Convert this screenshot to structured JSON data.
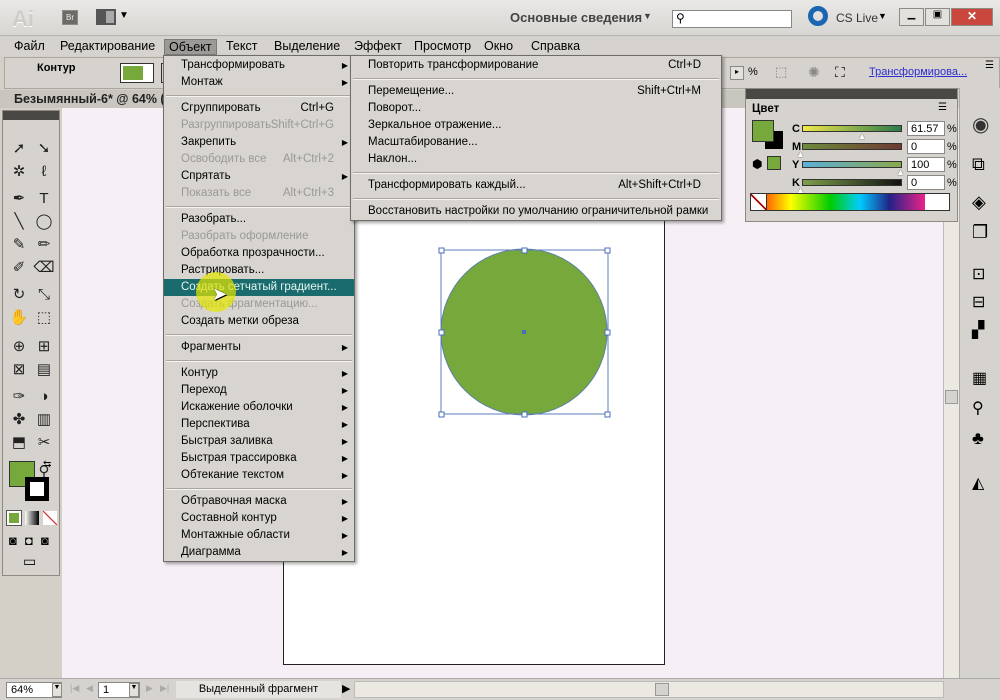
{
  "titlebar": {
    "app_logo": "Ai",
    "bridge": "Br",
    "workspace": "Основные сведения",
    "search_placeholder": "",
    "cs_live": "CS Live"
  },
  "menubar": [
    "Файл",
    "Редактирование",
    "Объект",
    "Текст",
    "Выделение",
    "Эффект",
    "Просмотр",
    "Окно",
    "Справка"
  ],
  "menubar_active": "Объект",
  "control": {
    "label": "Контур",
    "fill_color": "#76a83c",
    "percent": "%",
    "transform_link": "Трансформирова..."
  },
  "document": {
    "tab": "Безымянный-6* @ 64% ("
  },
  "object_menu": [
    {
      "label": "Трансформировать",
      "submenu": true
    },
    {
      "label": "Монтаж",
      "submenu": true
    },
    {
      "sep": true
    },
    {
      "label": "Сгруппировать",
      "shortcut": "Ctrl+G"
    },
    {
      "label": "Разгруппировать",
      "shortcut": "Shift+Ctrl+G",
      "disabled": true
    },
    {
      "label": "Закрепить",
      "submenu": true
    },
    {
      "label": "Освободить все",
      "shortcut": "Alt+Ctrl+2",
      "disabled": true
    },
    {
      "label": "Спрятать",
      "submenu": true
    },
    {
      "label": "Показать все",
      "shortcut": "Alt+Ctrl+3",
      "disabled": true
    },
    {
      "sep": true
    },
    {
      "label": "Разобрать..."
    },
    {
      "label": "Разобрать оформление",
      "disabled": true
    },
    {
      "label": "Обработка прозрачности..."
    },
    {
      "label": "Растрировать..."
    },
    {
      "label": "Создать сетчатый градиент...",
      "highlighted": true
    },
    {
      "label": "Создать фрагментацию...",
      "disabled": true
    },
    {
      "label": "Создать метки обреза"
    },
    {
      "sep": true
    },
    {
      "label": "Фрагменты",
      "submenu": true
    },
    {
      "sep": true
    },
    {
      "label": "Контур",
      "submenu": true
    },
    {
      "label": "Переход",
      "submenu": true
    },
    {
      "label": "Искажение оболочки",
      "submenu": true
    },
    {
      "label": "Перспектива",
      "submenu": true
    },
    {
      "label": "Быстрая заливка",
      "submenu": true
    },
    {
      "label": "Быстрая трассировка",
      "submenu": true
    },
    {
      "label": "Обтекание текстом",
      "submenu": true
    },
    {
      "sep": true
    },
    {
      "label": "Обтравочная маска",
      "submenu": true
    },
    {
      "label": "Составной контур",
      "submenu": true
    },
    {
      "label": "Монтажные области",
      "submenu": true
    },
    {
      "label": "Диаграмма",
      "submenu": true
    }
  ],
  "transform_submenu": [
    {
      "label": "Повторить трансформирование",
      "shortcut": "Ctrl+D"
    },
    {
      "sep": true
    },
    {
      "label": "Перемещение...",
      "shortcut": "Shift+Ctrl+M"
    },
    {
      "label": "Поворот..."
    },
    {
      "label": "Зеркальное отражение..."
    },
    {
      "label": "Масштабирование..."
    },
    {
      "label": "Наклон..."
    },
    {
      "sep": true
    },
    {
      "label": "Трансформировать каждый...",
      "shortcut": "Alt+Shift+Ctrl+D"
    },
    {
      "sep": true
    },
    {
      "label": "Восстановить настройки по умолчанию ограничительной рамки"
    }
  ],
  "color_panel": {
    "title": "Цвет",
    "fill": "#76a83c",
    "channels": [
      {
        "name": "C",
        "value": "61.57",
        "level": 61.57
      },
      {
        "name": "M",
        "value": "0",
        "level": 0
      },
      {
        "name": "Y",
        "value": "100",
        "level": 100
      },
      {
        "name": "K",
        "value": "0",
        "level": 0
      }
    ],
    "unit": "%"
  },
  "artwork": {
    "circle_color": "#76a83c"
  },
  "status": {
    "zoom": "64%",
    "page": "1",
    "mode": "Выделенный фрагмент"
  }
}
